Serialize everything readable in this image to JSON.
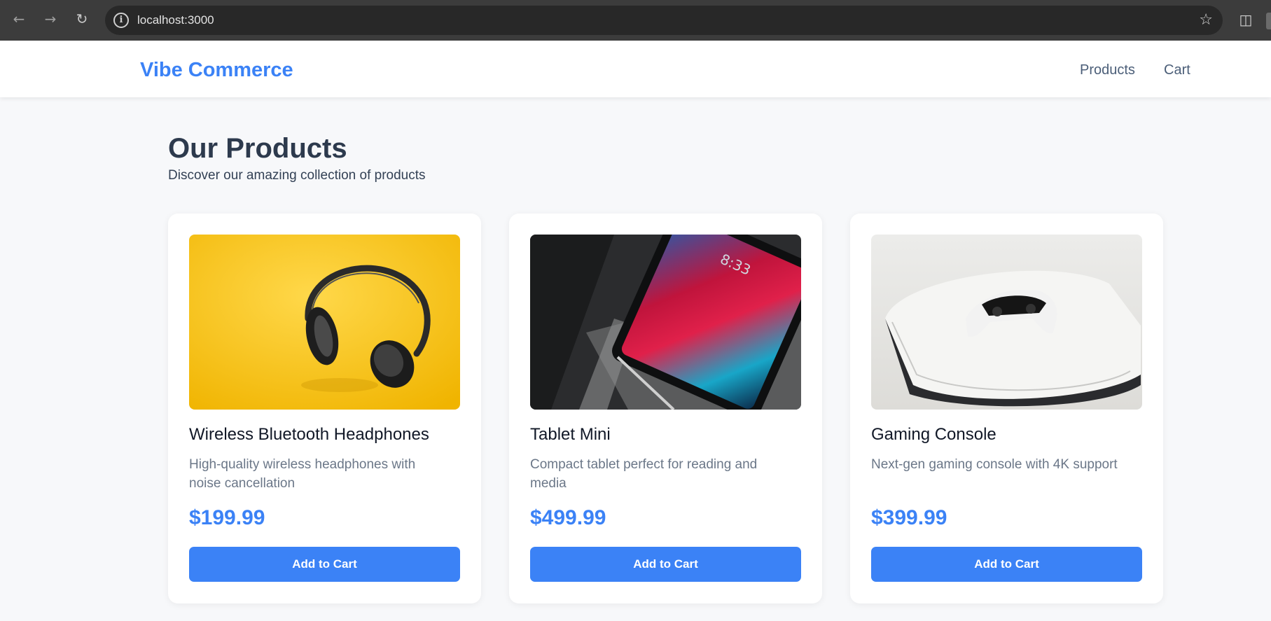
{
  "browser": {
    "url": "localhost:3000",
    "icons": [
      "back-arrow-icon",
      "forward-arrow-icon",
      "reload-icon",
      "site-info-icon",
      "bookmark-star-icon",
      "extensions-icon"
    ]
  },
  "header": {
    "logo": "Vibe Commerce",
    "nav": [
      {
        "label": "Products"
      },
      {
        "label": "Cart"
      }
    ]
  },
  "main": {
    "title": "Our Products",
    "subtitle": "Discover our amazing collection of products",
    "products": [
      {
        "name": "Wireless Bluetooth Headphones",
        "description": "High-quality wireless headphones with noise cancellation",
        "price": "$199.99",
        "button": "Add to Cart",
        "image_icon": "headphones-photo"
      },
      {
        "name": "Tablet Mini",
        "description": "Compact tablet perfect for reading and media",
        "price": "$499.99",
        "button": "Add to Cart",
        "image_icon": "tablet-photo"
      },
      {
        "name": "Gaming Console",
        "description": "Next-gen gaming console with 4K support",
        "price": "$399.99",
        "button": "Add to Cart",
        "image_icon": "game-console-photo"
      }
    ]
  },
  "colors": {
    "accent": "#3b82f6",
    "background": "#f7f8fa",
    "text_dark": "#2d3a4d",
    "text_muted": "#6b7788"
  }
}
